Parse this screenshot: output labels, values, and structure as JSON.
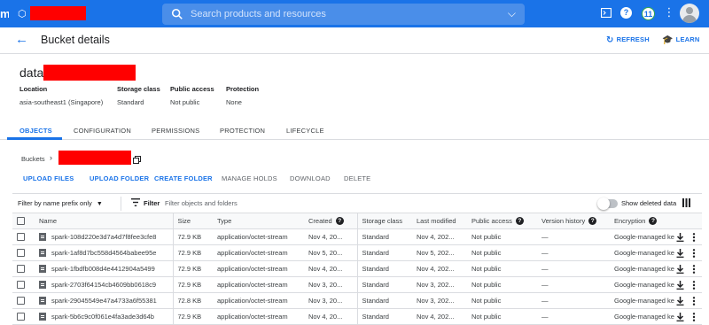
{
  "topbar": {
    "app_glyph": "m",
    "search_placeholder": "Search products and resources",
    "notification_count": "11",
    "icons": [
      "project-selector-icon",
      "search-icon",
      "chevron-down-icon",
      "cloud-shell-icon",
      "help-icon",
      "avatar-icon"
    ]
  },
  "header": {
    "title": "Bucket details",
    "refresh_label": "REFRESH",
    "learn_label": "LEARN"
  },
  "bucket": {
    "name_visible_prefix": "data",
    "location_label": "Location",
    "location_value": "asia-southeast1 (Singapore)",
    "storage_class_label": "Storage class",
    "storage_class_value": "Standard",
    "public_access_label": "Public access",
    "public_access_value": "Not public",
    "protection_label": "Protection",
    "protection_value": "None"
  },
  "tabs": [
    {
      "label": "OBJECTS",
      "active": true
    },
    {
      "label": "CONFIGURATION",
      "active": false
    },
    {
      "label": "PERMISSIONS",
      "active": false
    },
    {
      "label": "PROTECTION",
      "active": false
    },
    {
      "label": "LIFECYCLE",
      "active": false
    }
  ],
  "breadcrumb": {
    "root": "Buckets"
  },
  "actions": {
    "upload_files": "UPLOAD FILES",
    "upload_folder": "UPLOAD FOLDER",
    "create_folder": "CREATE FOLDER",
    "manage_holds": "MANAGE HOLDS",
    "download": "DOWNLOAD",
    "delete": "DELETE"
  },
  "filter": {
    "prefix_label": "Filter by name prefix only",
    "filter_label": "Filter",
    "placeholder": "Filter objects and folders",
    "show_deleted_label": "Show deleted data",
    "show_deleted_on": false
  },
  "table": {
    "columns": {
      "name": "Name",
      "size": "Size",
      "type": "Type",
      "created": "Created",
      "storage_class": "Storage class",
      "last_modified": "Last modified",
      "public_access": "Public access",
      "version_history": "Version history",
      "encryption": "Encryption"
    },
    "rows": [
      {
        "name": "spark-108d220e3d7a4d7f8fee3cfe8",
        "size": "72.9 KB",
        "type": "application/octet-stream",
        "created": "Nov 4, 20...",
        "storage_class": "Standard",
        "last_modified": "Nov 4, 202...",
        "public_access": "Not public",
        "version_history": "—",
        "encryption": "Google-managed key"
      },
      {
        "name": "spark-1af8d7bc558d4564babee95e",
        "size": "72.9 KB",
        "type": "application/octet-stream",
        "created": "Nov 5, 20...",
        "storage_class": "Standard",
        "last_modified": "Nov 5, 202...",
        "public_access": "Not public",
        "version_history": "—",
        "encryption": "Google-managed key"
      },
      {
        "name": "spark-1fbdfb008d4e4412904a5499",
        "size": "72.9 KB",
        "type": "application/octet-stream",
        "created": "Nov 4, 20...",
        "storage_class": "Standard",
        "last_modified": "Nov 4, 202...",
        "public_access": "Not public",
        "version_history": "—",
        "encryption": "Google-managed key"
      },
      {
        "name": "spark-2703f64154cb4609bb0618c9",
        "size": "72.9 KB",
        "type": "application/octet-stream",
        "created": "Nov 3, 20...",
        "storage_class": "Standard",
        "last_modified": "Nov 3, 202...",
        "public_access": "Not public",
        "version_history": "—",
        "encryption": "Google-managed key"
      },
      {
        "name": "spark-29045549e47a4733a6f55381",
        "size": "72.8 KB",
        "type": "application/octet-stream",
        "created": "Nov 3, 20...",
        "storage_class": "Standard",
        "last_modified": "Nov 3, 202...",
        "public_access": "Not public",
        "version_history": "—",
        "encryption": "Google-managed key"
      },
      {
        "name": "spark-5b6c9c0f061e4fa3ade3d64b",
        "size": "72.9 KB",
        "type": "application/octet-stream",
        "created": "Nov 4, 20...",
        "storage_class": "Standard",
        "last_modified": "Nov 4, 202...",
        "public_access": "Not public",
        "version_history": "—",
        "encryption": "Google-managed key"
      }
    ]
  },
  "colors": {
    "brand_blue": "#1a73e8",
    "redaction": "#ff0000",
    "text_primary": "#202124",
    "text_secondary": "#5f6368",
    "divider": "#dadce0"
  }
}
